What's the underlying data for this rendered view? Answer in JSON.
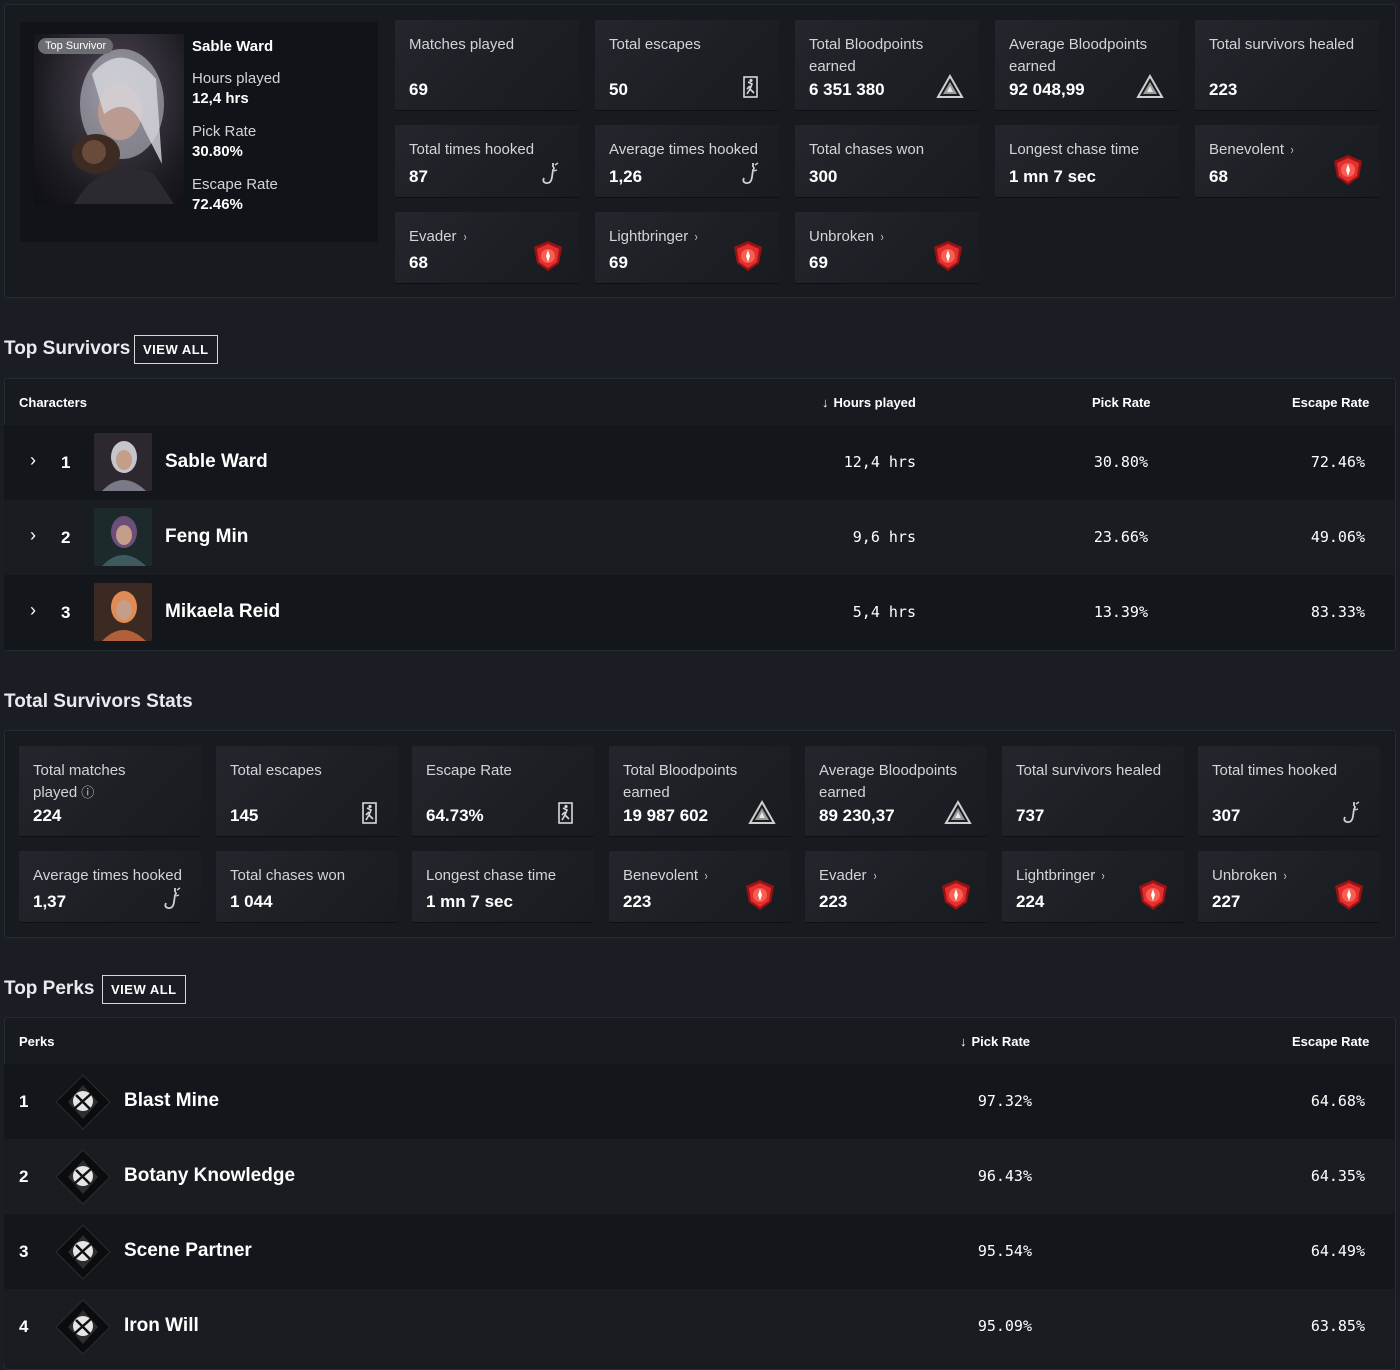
{
  "hero": {
    "tag": "Top Survivor",
    "name": "Sable Ward",
    "hours_label": "Hours played",
    "hours": "12,4 hrs",
    "pick_label": "Pick Rate",
    "pick": "30.80%",
    "escape_label": "Escape Rate",
    "escape": "72.46%"
  },
  "top_cards": [
    {
      "label": "Matches played",
      "value": "69",
      "icon": ""
    },
    {
      "label": "Total escapes",
      "value": "50",
      "icon": "escape-icon"
    },
    {
      "label": "Total Bloodpoints earned",
      "value": "6 351 380",
      "icon": "bloodpoints-icon"
    },
    {
      "label": "Average Bloodpoints earned",
      "value": "92 048,99",
      "icon": "bloodpoints-icon"
    },
    {
      "label": "Total survivors healed",
      "value": "223",
      "icon": ""
    },
    {
      "label": "Total times hooked",
      "value": "87",
      "icon": "hook-icon"
    },
    {
      "label": "Average times hooked",
      "value": "1,26",
      "icon": "hook-icon"
    },
    {
      "label": "Total chases won",
      "value": "300",
      "icon": ""
    },
    {
      "label": "Longest chase time",
      "value": "1 mn 7 sec",
      "icon": ""
    },
    {
      "label": "Benevolent",
      "value": "68",
      "icon": "achievement-icon"
    },
    {
      "label": "Evader",
      "value": "68",
      "icon": "achievement-icon"
    },
    {
      "label": "Lightbringer",
      "value": "69",
      "icon": "achievement-icon"
    },
    {
      "label": "Unbroken",
      "value": "69",
      "icon": "achievement-icon"
    }
  ],
  "top_survivors": {
    "title": "Top Survivors",
    "view_all": "VIEW ALL",
    "headers": {
      "characters": "Characters",
      "hours": "Hours played",
      "pick": "Pick Rate",
      "escape": "Escape Rate"
    },
    "rows": [
      {
        "rank": "1",
        "name": "Sable Ward",
        "hours": "12,4 hrs",
        "pick": "30.80%",
        "escape": "72.46%"
      },
      {
        "rank": "2",
        "name": "Feng Min",
        "hours": "9,6 hrs",
        "pick": "23.66%",
        "escape": "49.06%"
      },
      {
        "rank": "3",
        "name": "Mikaela Reid",
        "hours": "5,4 hrs",
        "pick": "13.39%",
        "escape": "83.33%"
      }
    ]
  },
  "total_stats": {
    "title": "Total Survivors Stats",
    "cards": [
      {
        "label": "Total matches played",
        "value": "224",
        "icon": "",
        "info": "ⓘ"
      },
      {
        "label": "Total escapes",
        "value": "145",
        "icon": "escape-icon"
      },
      {
        "label": "Escape Rate",
        "value": "64.73%",
        "icon": "escape-icon"
      },
      {
        "label": "Total Bloodpoints earned",
        "value": "19 987 602",
        "icon": "bloodpoints-icon"
      },
      {
        "label": "Average Bloodpoints earned",
        "value": "89 230,37",
        "icon": "bloodpoints-icon"
      },
      {
        "label": "Total survivors healed",
        "value": "737",
        "icon": ""
      },
      {
        "label": "Total times hooked",
        "value": "307",
        "icon": "hook-icon"
      },
      {
        "label": "Average times hooked",
        "value": "1,37",
        "icon": "hook-icon"
      },
      {
        "label": "Total chases won",
        "value": "1 044",
        "icon": ""
      },
      {
        "label": "Longest chase time",
        "value": "1 mn 7 sec",
        "icon": ""
      },
      {
        "label": "Benevolent",
        "value": "223",
        "icon": "achievement-icon"
      },
      {
        "label": "Evader",
        "value": "223",
        "icon": "achievement-icon"
      },
      {
        "label": "Lightbringer",
        "value": "224",
        "icon": "achievement-icon"
      },
      {
        "label": "Unbroken",
        "value": "227",
        "icon": "achievement-icon"
      }
    ]
  },
  "top_perks": {
    "title": "Top Perks",
    "view_all": "VIEW ALL",
    "headers": {
      "perks": "Perks",
      "pick": "Pick Rate",
      "escape": "Escape Rate"
    },
    "rows": [
      {
        "rank": "1",
        "name": "Blast Mine",
        "pick": "97.32%",
        "escape": "64.68%"
      },
      {
        "rank": "2",
        "name": "Botany Knowledge",
        "pick": "96.43%",
        "escape": "64.35%"
      },
      {
        "rank": "3",
        "name": "Scene Partner",
        "pick": "95.54%",
        "escape": "64.49%"
      },
      {
        "rank": "4",
        "name": "Iron Will",
        "pick": "95.09%",
        "escape": "63.85%"
      }
    ]
  },
  "chevron": "›",
  "sort_arrow": "↓"
}
